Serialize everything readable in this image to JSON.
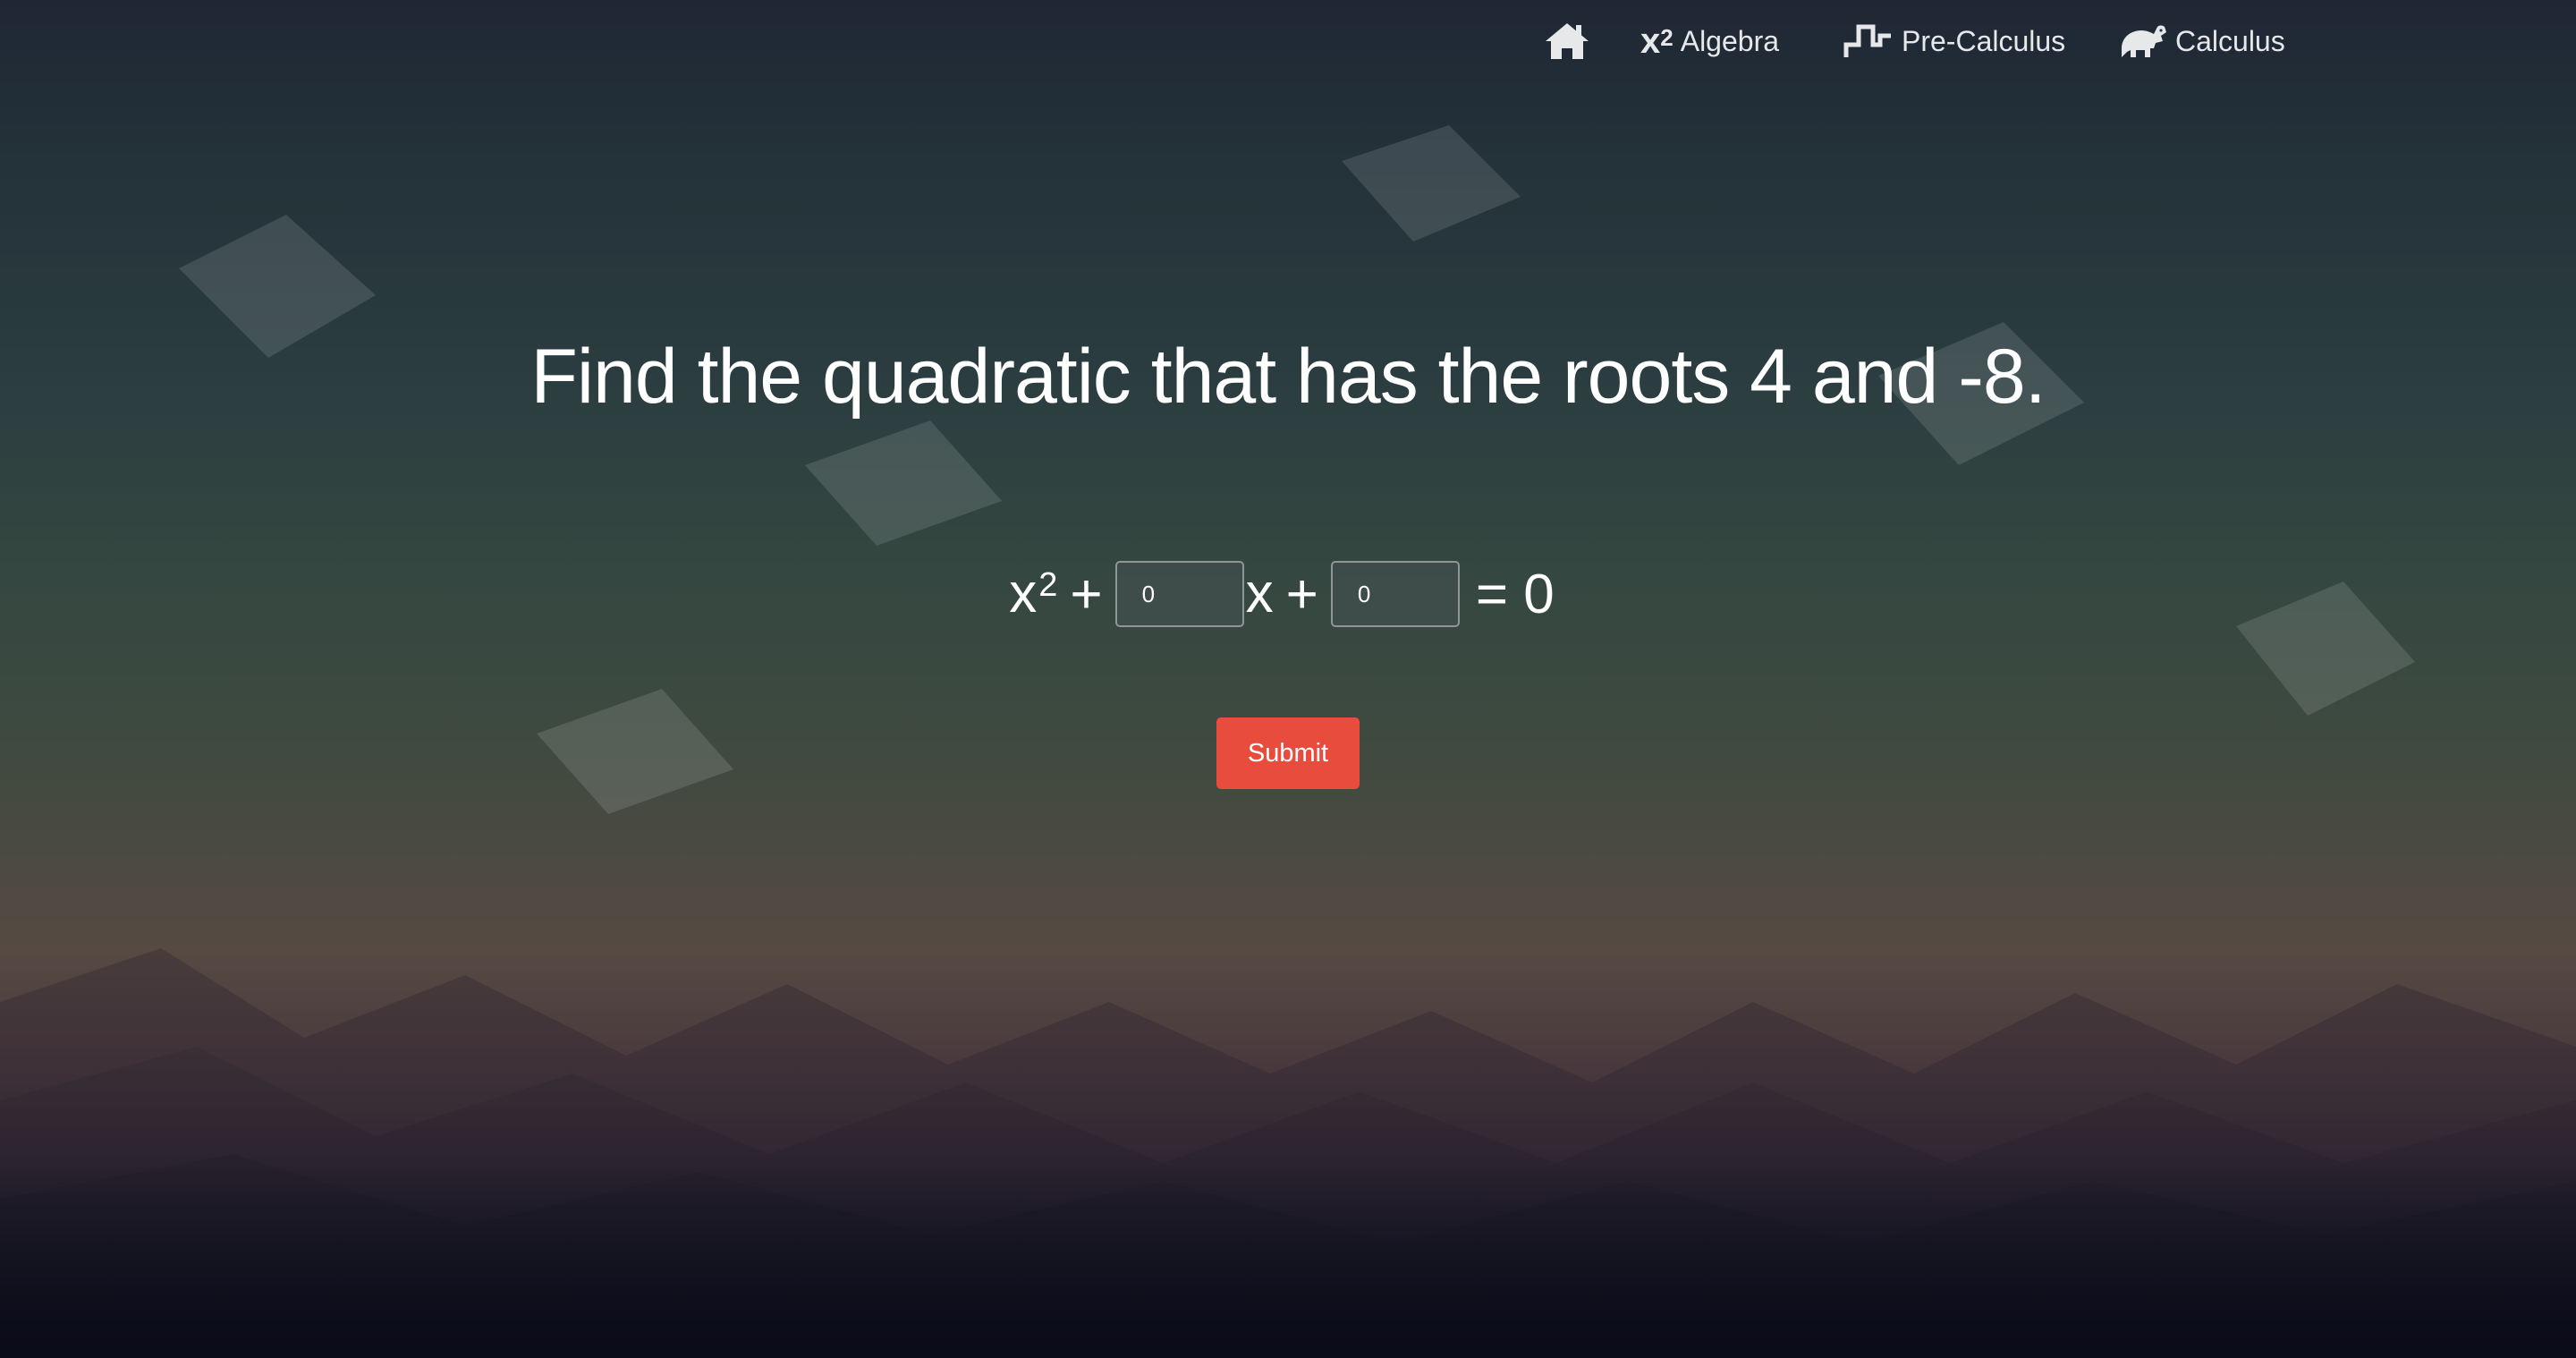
{
  "nav": {
    "home": {
      "icon": "home-icon"
    },
    "items": [
      {
        "label": "Algebra",
        "icon": "x-squared-icon",
        "icon_text": "x",
        "icon_sup": "2"
      },
      {
        "label": "Pre-Calculus",
        "icon": "step-function-icon"
      },
      {
        "label": "Calculus",
        "icon": "dinosaur-icon"
      }
    ]
  },
  "question": {
    "text": "Find the quadratic that has the roots 4 and -8."
  },
  "equation": {
    "variable": "x",
    "exponent": "2",
    "plus1": "+",
    "linear_var": "x",
    "plus2": "+",
    "equals": "= 0",
    "inputs": [
      {
        "value": "0"
      },
      {
        "value": "0"
      }
    ]
  },
  "submit": {
    "label": "Submit"
  },
  "colors": {
    "accent": "#e74c3c",
    "nav_text": "#e6e8ea",
    "background_top": "#1f2734",
    "background_bottom": "#0d0e1d"
  }
}
